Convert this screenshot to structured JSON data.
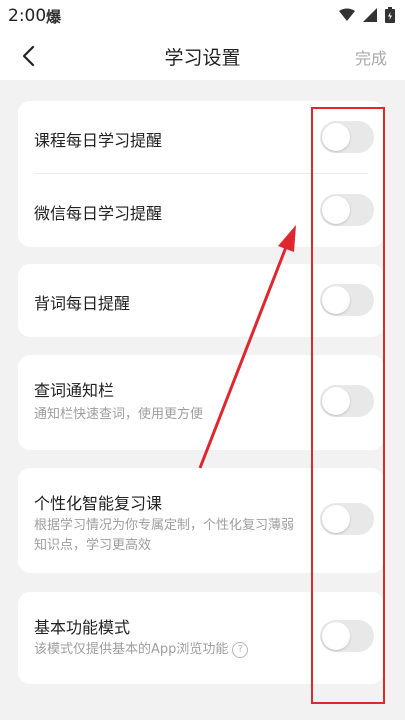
{
  "status_bar": {
    "time": "2:00",
    "notification_glyph": "爆"
  },
  "header": {
    "title": "学习设置",
    "done_label": "完成"
  },
  "settings": [
    {
      "label": "课程每日学习提醒",
      "description": "",
      "enabled": false
    },
    {
      "label": "微信每日学习提醒",
      "description": "",
      "enabled": false
    },
    {
      "label": "背词每日提醒",
      "description": "",
      "enabled": false
    },
    {
      "label": "查词通知栏",
      "description": "通知栏快速查词，使用更方便",
      "enabled": false
    },
    {
      "label": "个性化智能复习课",
      "description": "根据学习情况为你专属定制，个性化复习薄弱知识点，学习更高效",
      "enabled": false
    },
    {
      "label": "基本功能模式",
      "description": "该模式仅提供基本的App浏览功能",
      "enabled": false
    }
  ],
  "colors": {
    "annotation": "#e0262f",
    "toggle_off": "#e8e8e8"
  }
}
